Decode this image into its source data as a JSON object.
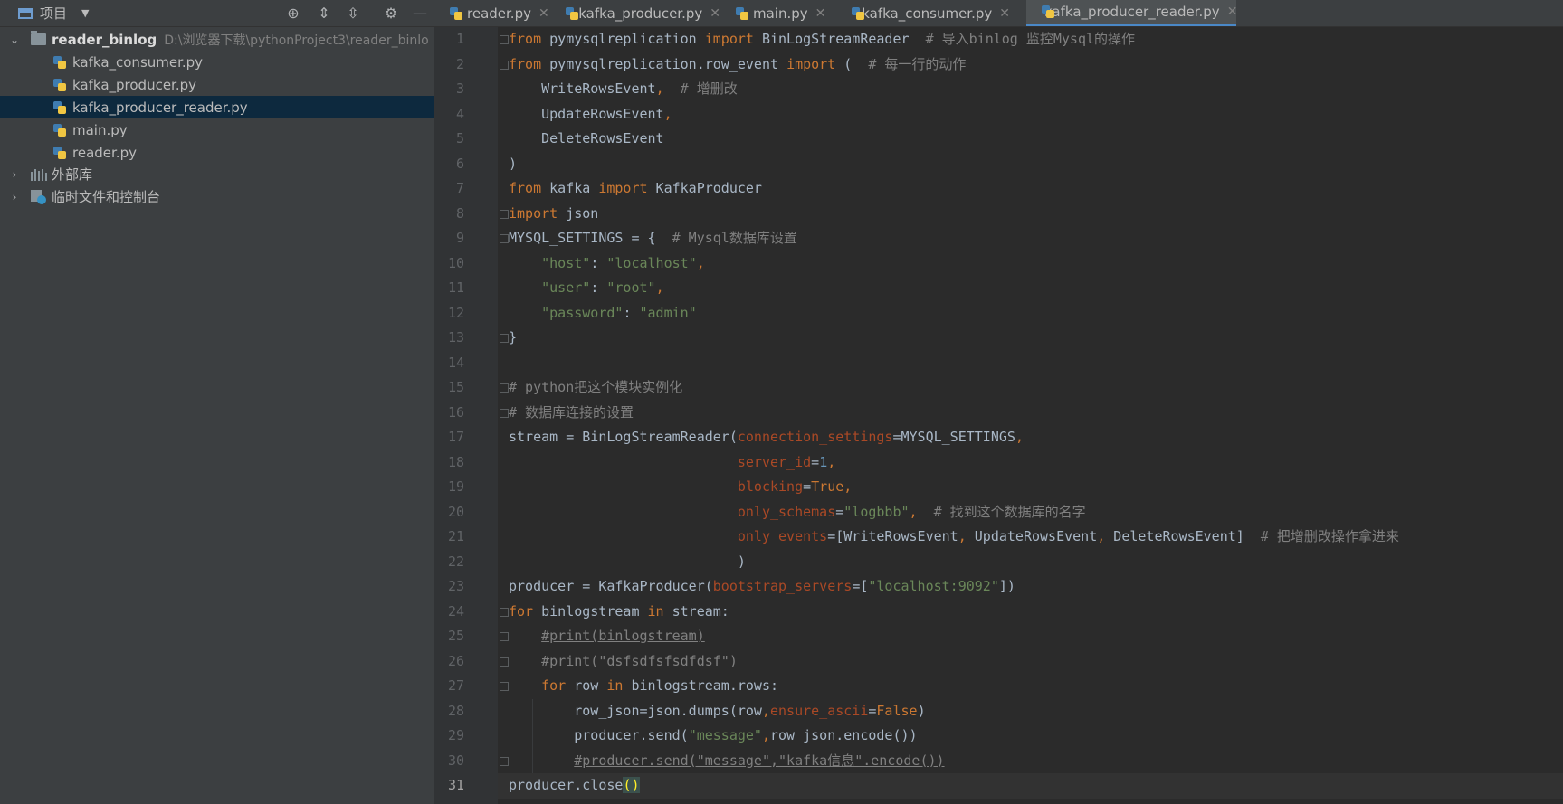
{
  "sidebar": {
    "title": "项目",
    "root": {
      "name": "reader_binlog",
      "path": "D:\\浏览器下载\\pythonProject3\\reader_binlo"
    },
    "files": [
      "kafka_consumer.py",
      "kafka_producer.py",
      "kafka_producer_reader.py",
      "main.py",
      "reader.py"
    ],
    "groups": [
      "外部库",
      "临时文件和控制台"
    ]
  },
  "tabs": [
    {
      "label": "reader.py",
      "active": false
    },
    {
      "label": "kafka_producer.py",
      "active": false
    },
    {
      "label": "main.py",
      "active": false
    },
    {
      "label": "kafka_consumer.py",
      "active": false
    },
    {
      "label": "kafka_producer_reader.py",
      "active": true
    }
  ],
  "editor": {
    "current_line": 31,
    "line_numbers": [
      "1",
      "2",
      "3",
      "4",
      "5",
      "6",
      "7",
      "8",
      "9",
      "10",
      "11",
      "12",
      "13",
      "14",
      "15",
      "16",
      "17",
      "18",
      "19",
      "20",
      "21",
      "22",
      "23",
      "24",
      "25",
      "26",
      "27",
      "28",
      "29",
      "30",
      "31"
    ],
    "code": [
      [
        [
          "k",
          "from"
        ],
        [
          "t",
          " pymysqlreplication "
        ],
        [
          "k",
          "import"
        ],
        [
          "t",
          " BinLogStreamReader  "
        ],
        [
          "c",
          "# 导入binlog 监控Mysql的操作"
        ]
      ],
      [
        [
          "k",
          "from"
        ],
        [
          "t",
          " pymysqlreplication.row_event "
        ],
        [
          "k",
          "import"
        ],
        [
          "t",
          " (  "
        ],
        [
          "c",
          "# 每一行的动作"
        ]
      ],
      [
        [
          "t",
          "    WriteRowsEvent"
        ],
        [
          "k",
          ","
        ],
        [
          "t",
          "  "
        ],
        [
          "c",
          "# 增删改"
        ]
      ],
      [
        [
          "t",
          "    UpdateRowsEvent"
        ],
        [
          "k",
          ","
        ]
      ],
      [
        [
          "t",
          "    DeleteRowsEvent"
        ]
      ],
      [
        [
          "t",
          ")"
        ]
      ],
      [
        [
          "k",
          "from"
        ],
        [
          "t",
          " kafka "
        ],
        [
          "k",
          "import"
        ],
        [
          "t",
          " KafkaProducer"
        ]
      ],
      [
        [
          "k",
          "import"
        ],
        [
          "t",
          " json"
        ]
      ],
      [
        [
          "t",
          "MYSQL_SETTINGS = {  "
        ],
        [
          "c",
          "# Mysql数据库设置"
        ]
      ],
      [
        [
          "t",
          "    "
        ],
        [
          "s",
          "\"host\""
        ],
        [
          "t",
          ": "
        ],
        [
          "s",
          "\"localhost\""
        ],
        [
          "k",
          ","
        ]
      ],
      [
        [
          "t",
          "    "
        ],
        [
          "s",
          "\"user\""
        ],
        [
          "t",
          ": "
        ],
        [
          "s",
          "\"root\""
        ],
        [
          "k",
          ","
        ]
      ],
      [
        [
          "t",
          "    "
        ],
        [
          "s",
          "\"password\""
        ],
        [
          "t",
          ": "
        ],
        [
          "s",
          "\"admin\""
        ]
      ],
      [
        [
          "t",
          "}"
        ]
      ],
      [],
      [
        [
          "c",
          "# python把这个模块实例化"
        ]
      ],
      [
        [
          "c",
          "# 数据库连接的设置"
        ]
      ],
      [
        [
          "t",
          "stream = BinLogStreamReader("
        ],
        [
          "p",
          "connection_settings"
        ],
        [
          "t",
          "=MYSQL_SETTINGS"
        ],
        [
          "k",
          ","
        ]
      ],
      [
        [
          "t",
          "                            "
        ],
        [
          "p",
          "server_id"
        ],
        [
          "t",
          "="
        ],
        [
          "n",
          "1"
        ],
        [
          "k",
          ","
        ]
      ],
      [
        [
          "t",
          "                            "
        ],
        [
          "p",
          "blocking"
        ],
        [
          "t",
          "="
        ],
        [
          "k",
          "True"
        ],
        [
          "k",
          ","
        ]
      ],
      [
        [
          "t",
          "                            "
        ],
        [
          "p",
          "only_schemas"
        ],
        [
          "t",
          "="
        ],
        [
          "s",
          "\"logbbb\""
        ],
        [
          "k",
          ","
        ],
        [
          "t",
          "  "
        ],
        [
          "c",
          "# 找到这个数据库的名字"
        ]
      ],
      [
        [
          "t",
          "                            "
        ],
        [
          "p",
          "only_events"
        ],
        [
          "t",
          "=[WriteRowsEvent"
        ],
        [
          "k",
          ","
        ],
        [
          "t",
          " UpdateRowsEvent"
        ],
        [
          "k",
          ","
        ],
        [
          "t",
          " DeleteRowsEvent]  "
        ],
        [
          "c",
          "# 把增删改操作拿进来"
        ]
      ],
      [
        [
          "t",
          "                            )"
        ]
      ],
      [
        [
          "t",
          "producer = KafkaProducer("
        ],
        [
          "p",
          "bootstrap_servers"
        ],
        [
          "t",
          "=["
        ],
        [
          "s",
          "\"localhost:9092\""
        ],
        [
          "t",
          "])"
        ]
      ],
      [
        [
          "k",
          "for"
        ],
        [
          "t",
          " binlogstream "
        ],
        [
          "k",
          "in"
        ],
        [
          "t",
          " stream:"
        ]
      ],
      [
        [
          "t",
          "    "
        ],
        [
          "cm",
          "#print(binlogstream)"
        ]
      ],
      [
        [
          "t",
          "    "
        ],
        [
          "cm",
          "#print(\"dsfsdfsfsdfdsf\")"
        ]
      ],
      [
        [
          "t",
          "    "
        ],
        [
          "k",
          "for"
        ],
        [
          "t",
          " row "
        ],
        [
          "k",
          "in"
        ],
        [
          "t",
          " binlogstream.rows:"
        ]
      ],
      [
        [
          "t",
          "        row_json=json.dumps(row"
        ],
        [
          "k",
          ","
        ],
        [
          "p",
          "ensure_ascii"
        ],
        [
          "t",
          "="
        ],
        [
          "k",
          "False"
        ],
        [
          "t",
          ")"
        ]
      ],
      [
        [
          "t",
          "        producer.send("
        ],
        [
          "s",
          "\"message\""
        ],
        [
          "k",
          ","
        ],
        [
          "t",
          "row_json.encode())"
        ]
      ],
      [
        [
          "t",
          "        "
        ],
        [
          "cm",
          "#producer.send(\"message\",\"kafka信息\".encode())"
        ]
      ],
      [
        [
          "t",
          "producer.close"
        ],
        [
          "br",
          "()"
        ]
      ]
    ]
  },
  "icons": {
    "toolbar": [
      "locate-icon",
      "expand-all-icon",
      "collapse-all-icon",
      "gear-icon",
      "minimize-icon"
    ]
  }
}
